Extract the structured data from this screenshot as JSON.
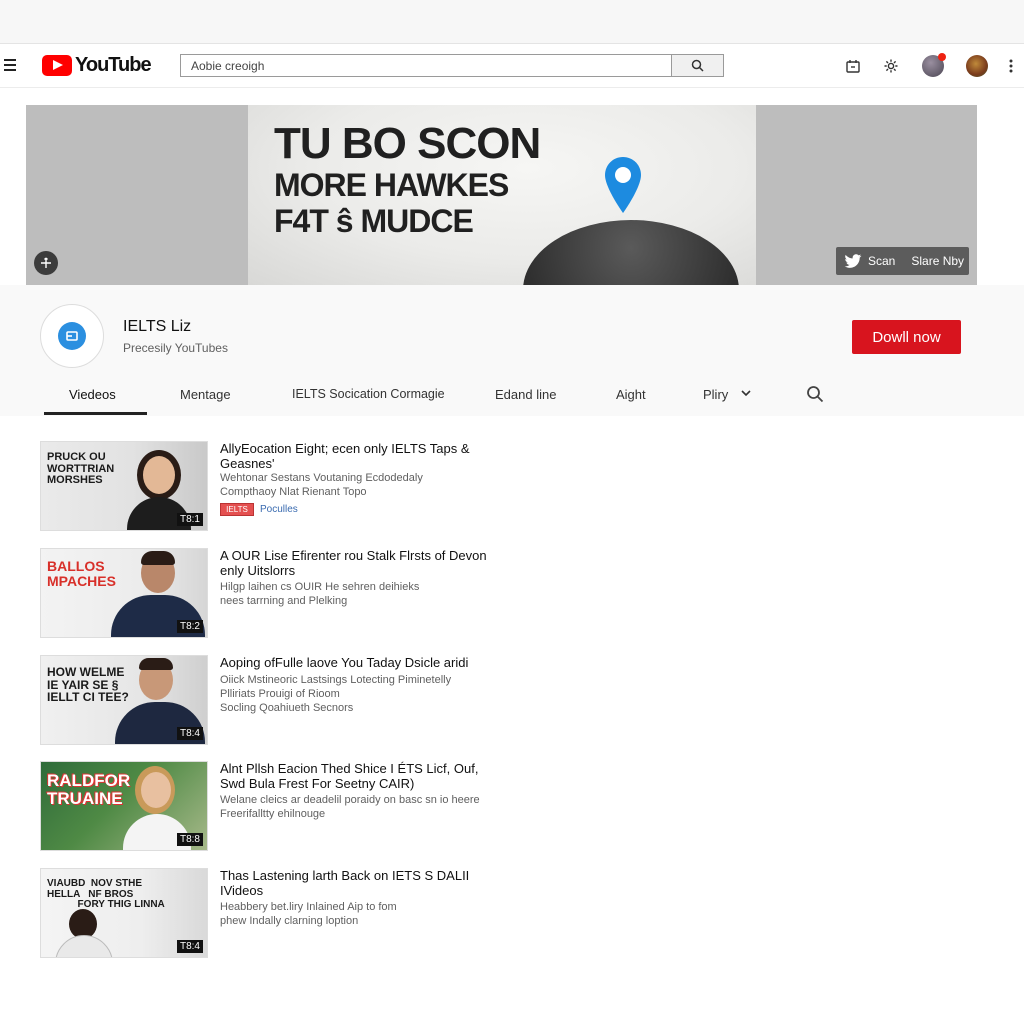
{
  "header": {
    "logo_text": "YouTube",
    "search_placeholder": "Aobie creoigh"
  },
  "banner": {
    "lines": [
      "TU BO SCON",
      "MORE HAWKES",
      "F4T ŝ MUDCE"
    ],
    "social_label_1": "Scan",
    "social_label_2": "Slare Nby"
  },
  "channel": {
    "name": "IELTS Liz",
    "subtitle": "Precesily YouTubes",
    "cta_label": "Dowll now"
  },
  "tabs": [
    {
      "label": "Viedeos"
    },
    {
      "label": "Mentage"
    },
    {
      "label": "IELTS Socication Cormagie"
    },
    {
      "label": "Edand line"
    },
    {
      "label": "Aight"
    },
    {
      "label": "Pliry"
    }
  ],
  "videos": [
    {
      "thumb_text": "PRUCK OU\nWORTTRIAN\nMORSHES",
      "thumb_color": "#1a1a1a",
      "duration": "T8:1",
      "title": "AllyEocation Eight; ecen only IELTS Taps & Geasnes'",
      "desc_lines": [
        "Wehtonar Sestans Voutaning Ecdodedaly",
        "Compthaoy Nlat Rienant Topo"
      ],
      "badge": "IELTS",
      "channel": "Poculles"
    },
    {
      "thumb_text": "BALLOS\nMPACHES",
      "thumb_color": "#d8302a",
      "duration": "T8:2",
      "title": "A OUR Lise Efirenter rou Stalk Flrsts of Devon enly Uitslorrs",
      "desc_lines": [
        "Hilgp laihen cs OUIR He sehren deihieks",
        "nees tarrning and Plelking"
      ]
    },
    {
      "thumb_text": "HOW WELME\nIE YAIR SE §\nIELLT CI TEE?",
      "thumb_color": "#1a1a1a",
      "duration": "T8:4",
      "title": "Aoping ofFulle laove You Taday Dsicle aridi",
      "desc_lines": [
        "Oiick Mstineoric Lastsings Lotecting Piminetelly",
        "Plliriats Prouigi of Rioom",
        "Socling Qoahiueth Secnors"
      ]
    },
    {
      "thumb_text": "RALDFOR\nTRUAINE",
      "thumb_color": "#ffffff",
      "duration": "T8:8",
      "title": "Alnt Pllsh Eacion Thed Shice I ÉTS Licf, Ouf, Swd Bula Frest For Seetny CAIR)",
      "desc_lines": [
        "Welane cleics ar deadelil poraidy on basc sn io heere",
        "Freerifalltty ehilnouge"
      ]
    },
    {
      "thumb_text": "VIAUBD  NOV STHE\nHELLA   NF BROS\n           FORY THIG LINNA",
      "thumb_color": "#d8302a",
      "duration": "T8:4",
      "title": "Thas Lastening larth Back on IETS S DALII IVideos",
      "desc_lines": [
        "Heabbery bet.liry Inlained Aip to fom",
        "phew Indally clarning loption"
      ]
    }
  ],
  "colors": {
    "brand_red": "#ff0000",
    "cta_red": "#d8141e",
    "pin_blue": "#1d8be0"
  }
}
